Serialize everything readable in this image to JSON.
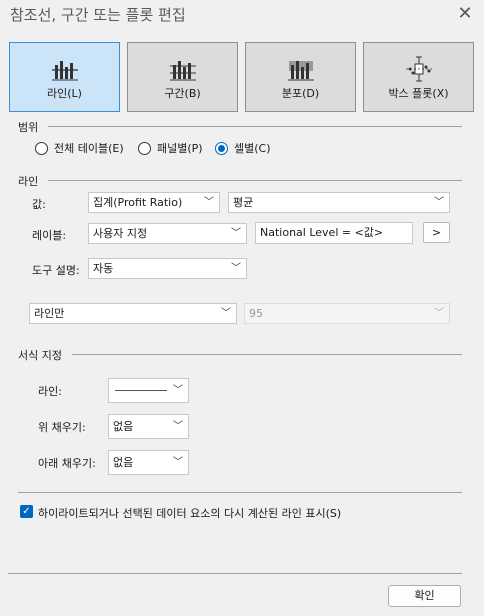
{
  "dialog": {
    "title": "참조선, 구간 또는 플롯 편집",
    "close_glyph": "✕"
  },
  "types": [
    {
      "label": "라인(L)",
      "selected": true
    },
    {
      "label": "구간(B)",
      "selected": false
    },
    {
      "label": "분포(D)",
      "selected": false
    },
    {
      "label": "박스 플롯(X)",
      "selected": false
    }
  ],
  "scope": {
    "heading": "범위",
    "options": [
      {
        "label": "전체 테이블(E)",
        "checked": false
      },
      {
        "label": "패널별(P)",
        "checked": false
      },
      {
        "label": "셀별(C)",
        "checked": true
      }
    ]
  },
  "line": {
    "heading": "라인",
    "value_label": "값:",
    "value_field": "집계(Profit Ratio)",
    "value_agg": "평균",
    "label_label": "레이블:",
    "label_mode": "사용자 지정",
    "label_text": "National Level = <값>",
    "label_insert_btn": ">",
    "tooltip_label": "도구 설명:",
    "tooltip_mode": "자동",
    "ci_mode": "라인만",
    "ci_value": "95"
  },
  "format": {
    "heading": "서식 지정",
    "line_label": "라인:",
    "fill_above_label": "위 채우기:",
    "fill_above_value": "없음",
    "fill_below_label": "아래 채우기:",
    "fill_below_value": "없음"
  },
  "recalc": {
    "label": "하이라이트되거나 선택된 데이터 요소의 다시 계산된 라인 표시(S)",
    "checked": true
  },
  "footer": {
    "ok_label": "확인"
  },
  "colors": {
    "accent": "#0067c0",
    "selected_bg": "#cce4f7"
  }
}
